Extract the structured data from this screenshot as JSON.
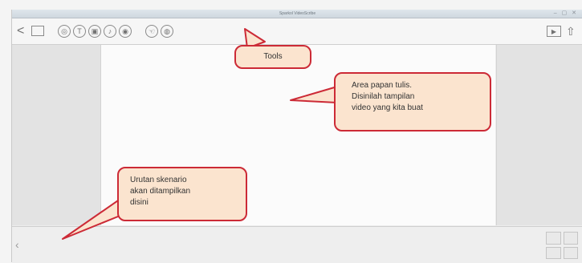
{
  "window": {
    "title": "Sparkol VideoScribe",
    "controls": "– ▢ ✕"
  },
  "toolbar": {
    "back_label": "<",
    "icons": [
      {
        "name": "back-icon",
        "glyph": "<"
      },
      {
        "name": "save-icon",
        "glyph": "▭"
      },
      {
        "name": "image-icon",
        "glyph": "◎"
      },
      {
        "name": "text-icon",
        "glyph": "T"
      },
      {
        "name": "chart-icon",
        "glyph": "▣"
      },
      {
        "name": "music-icon",
        "glyph": "♪"
      },
      {
        "name": "voice-icon",
        "glyph": "◉"
      },
      {
        "name": "hand-icon",
        "glyph": "☜"
      },
      {
        "name": "settings-icon",
        "glyph": "◍"
      },
      {
        "name": "play-icon",
        "glyph": "▶"
      },
      {
        "name": "share-icon",
        "glyph": "⇧"
      }
    ]
  },
  "callouts": {
    "tools": "Tools",
    "canvas": "Area papan tulis.\nDisinilah tampilan\nvideo yang kita buat",
    "scenario": "Urutan skenario\nakan ditampilkan\ndisini"
  },
  "scenario_bar": {
    "scroll_glyph": "‹"
  },
  "colors": {
    "callout_fill": "#fbe4cf",
    "callout_border": "#cc2a36"
  }
}
